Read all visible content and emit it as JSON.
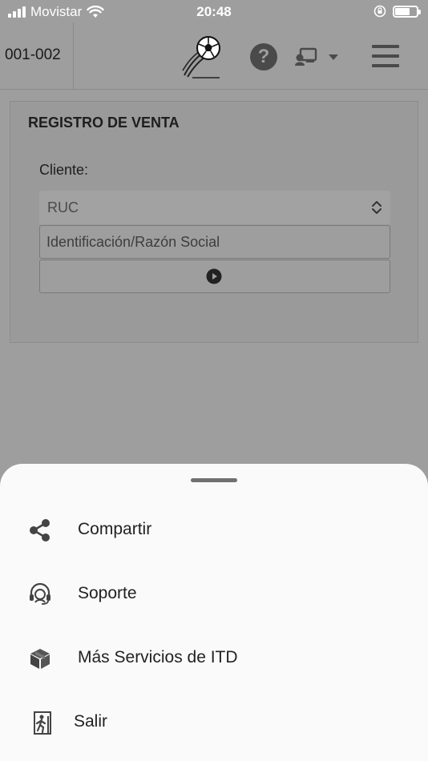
{
  "status_bar": {
    "carrier": "Movistar",
    "time": "20:48"
  },
  "header": {
    "branch_code": "001-002",
    "help_symbol": "?",
    "icons": [
      "soccer-ball-logo",
      "help-icon",
      "user-card-icon",
      "caret-down-icon",
      "hamburger-menu-icon"
    ]
  },
  "form": {
    "title": "REGISTRO DE VENTA",
    "client_label": "Cliente:",
    "document_type": {
      "selected": "RUC"
    },
    "identification": {
      "placeholder": "Identificación/Razón Social",
      "value": ""
    }
  },
  "sheet": {
    "items": [
      {
        "label": "Compartir",
        "icon": "share-icon"
      },
      {
        "label": "Soporte",
        "icon": "headset-icon"
      },
      {
        "label": "Más Servicios de ITD",
        "icon": "package-icon"
      },
      {
        "label": "Salir",
        "icon": "exit-icon"
      }
    ]
  },
  "colors": {
    "overlay": "#9e9e9e",
    "sheet_background": "#fafafa",
    "icon_dark": "#4a4a4a"
  }
}
